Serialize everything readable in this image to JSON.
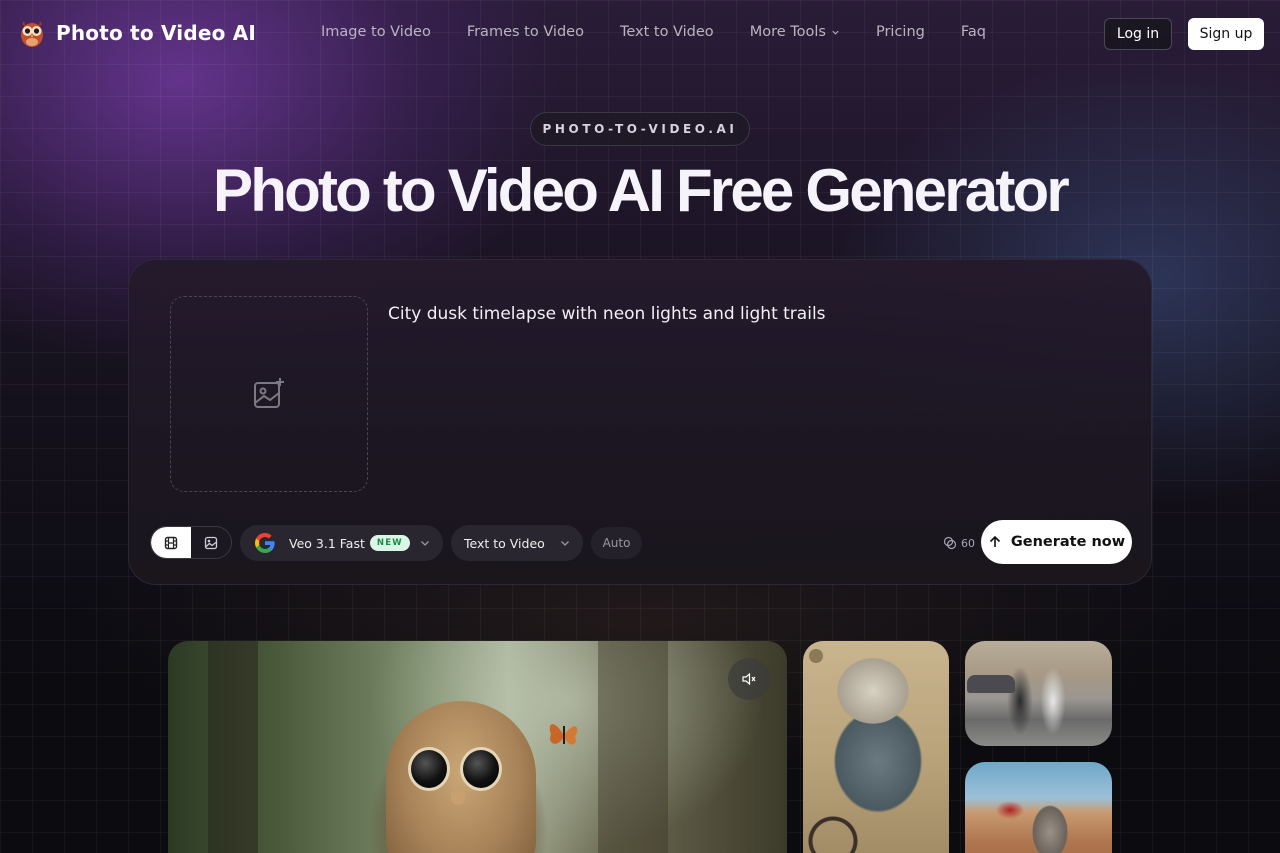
{
  "brand": {
    "name": "Photo to Video AI",
    "logo": "owl-logo"
  },
  "nav": {
    "items": [
      {
        "label": "Image to Video"
      },
      {
        "label": "Frames to Video"
      },
      {
        "label": "Text to Video"
      },
      {
        "label": "More Tools",
        "icon": "chevron-down-icon"
      },
      {
        "label": "Pricing"
      },
      {
        "label": "Faq"
      }
    ],
    "login_label": "Log in",
    "signup_label": "Sign up"
  },
  "hero": {
    "eyebrow": "PHOTO-TO-VIDEO.AI",
    "title": "Photo to Video AI Free Generator"
  },
  "generator": {
    "upload_icon": "image-plus-icon",
    "prompt": "City dusk timelapse with neon lights and light trails",
    "media_toggle": [
      {
        "icon": "film-icon",
        "active": true
      },
      {
        "icon": "image-icon",
        "active": false
      }
    ],
    "model": {
      "name": "Veo 3.1 Fast",
      "badge": "NEW",
      "icon": "google-logo-icon"
    },
    "mode": "Text to Video",
    "aspect": "Auto",
    "credits": "60",
    "credits_icon": "coins-icon",
    "generate_label": "Generate now",
    "generate_icon": "arrow-up-icon"
  },
  "gallery": {
    "items": [
      {
        "name": "owl-forest-video",
        "mute_icon": "volume-mute-icon"
      },
      {
        "name": "creature-bicycle-video"
      },
      {
        "name": "runners-street-video"
      },
      {
        "name": "lemur-desert-video"
      }
    ]
  },
  "colors": {
    "accent_purple": "#7a3ca8",
    "button_white": "#ffffff",
    "badge_green_bg": "#d9f7e4",
    "badge_green_text": "#1f8a48"
  }
}
